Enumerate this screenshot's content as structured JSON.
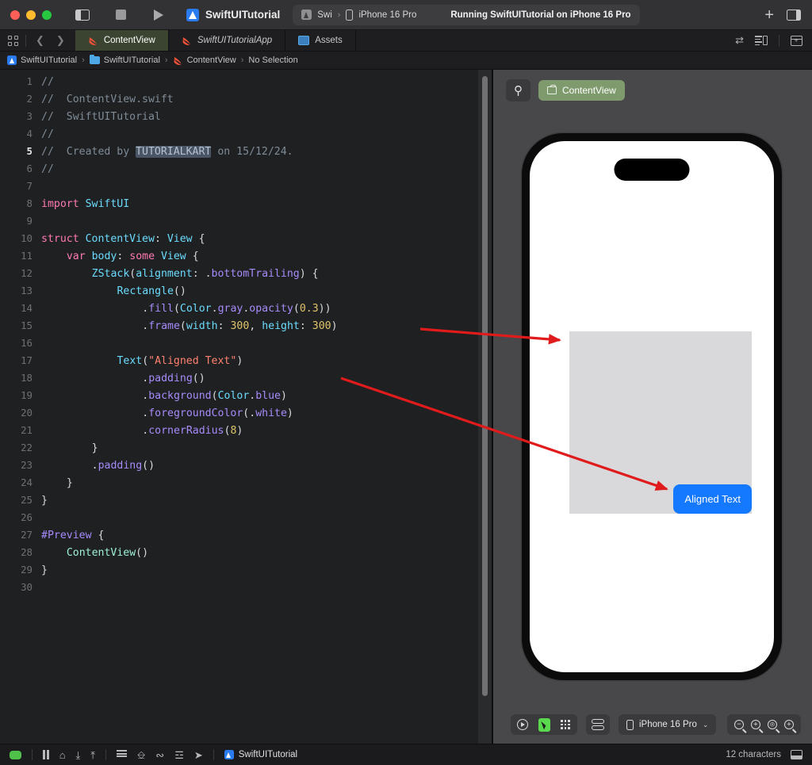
{
  "window": {
    "title": "SwiftUITutorial",
    "run_status": "Running SwiftUITutorial on iPhone 16 Pro",
    "scheme": "Swi",
    "scheme_separator": "›",
    "destination": "iPhone 16 Pro",
    "accent_blue": "#2a7af0",
    "active_tab_bg": "#3a4430"
  },
  "tabs": [
    {
      "label": "ContentView",
      "icon": "swift-icon",
      "active": true
    },
    {
      "label": "SwiftUITutorialApp",
      "icon": "swift-icon",
      "active": false
    },
    {
      "label": "Assets",
      "icon": "assets-icon",
      "active": false
    }
  ],
  "breadcrumb": {
    "project": "SwiftUITutorial",
    "folder": "SwiftUITutorial",
    "file": "ContentView",
    "selection": "No Selection",
    "separator": "›"
  },
  "editor": {
    "current_line": 5,
    "total_lines": 30,
    "highlighted_token": "TUTORIALKART",
    "lines": [
      {
        "n": 1,
        "text": "//"
      },
      {
        "n": 2,
        "text": "//  ContentView.swift"
      },
      {
        "n": 3,
        "text": "//  SwiftUITutorial"
      },
      {
        "n": 4,
        "text": "//"
      },
      {
        "n": 5,
        "text": "//  Created by TUTORIALKART on 15/12/24."
      },
      {
        "n": 6,
        "text": "//"
      },
      {
        "n": 7,
        "text": ""
      },
      {
        "n": 8,
        "text": "import SwiftUI"
      },
      {
        "n": 9,
        "text": ""
      },
      {
        "n": 10,
        "text": "struct ContentView: View {"
      },
      {
        "n": 11,
        "text": "    var body: some View {"
      },
      {
        "n": 12,
        "text": "        ZStack(alignment: .bottomTrailing) {"
      },
      {
        "n": 13,
        "text": "            Rectangle()"
      },
      {
        "n": 14,
        "text": "                .fill(Color.gray.opacity(0.3))"
      },
      {
        "n": 15,
        "text": "                .frame(width: 300, height: 300)"
      },
      {
        "n": 16,
        "text": ""
      },
      {
        "n": 17,
        "text": "            Text(\"Aligned Text\")"
      },
      {
        "n": 18,
        "text": "                .padding()"
      },
      {
        "n": 19,
        "text": "                .background(Color.blue)"
      },
      {
        "n": 20,
        "text": "                .foregroundColor(.white)"
      },
      {
        "n": 21,
        "text": "                .cornerRadius(8)"
      },
      {
        "n": 22,
        "text": "        }"
      },
      {
        "n": 23,
        "text": "        .padding()"
      },
      {
        "n": 24,
        "text": "    }"
      },
      {
        "n": 25,
        "text": "}"
      },
      {
        "n": 26,
        "text": ""
      },
      {
        "n": 27,
        "text": "#Preview {"
      },
      {
        "n": 28,
        "text": "    ContentView()"
      },
      {
        "n": 29,
        "text": "}"
      },
      {
        "n": 30,
        "text": ""
      }
    ]
  },
  "canvas": {
    "preview_chip": "ContentView",
    "device": "iPhone 16 Pro",
    "chevron": "⌄",
    "preview_button_label": "Aligned Text",
    "preview_button_color": "#1479ff",
    "preview_rect_color": "#d9d9dc",
    "zoom_buttons": [
      "zoom-out",
      "zoom-in",
      "zoom-fit",
      "zoom-actual"
    ]
  },
  "statusbar": {
    "project": "SwiftUITutorial",
    "characters": "12 characters"
  }
}
